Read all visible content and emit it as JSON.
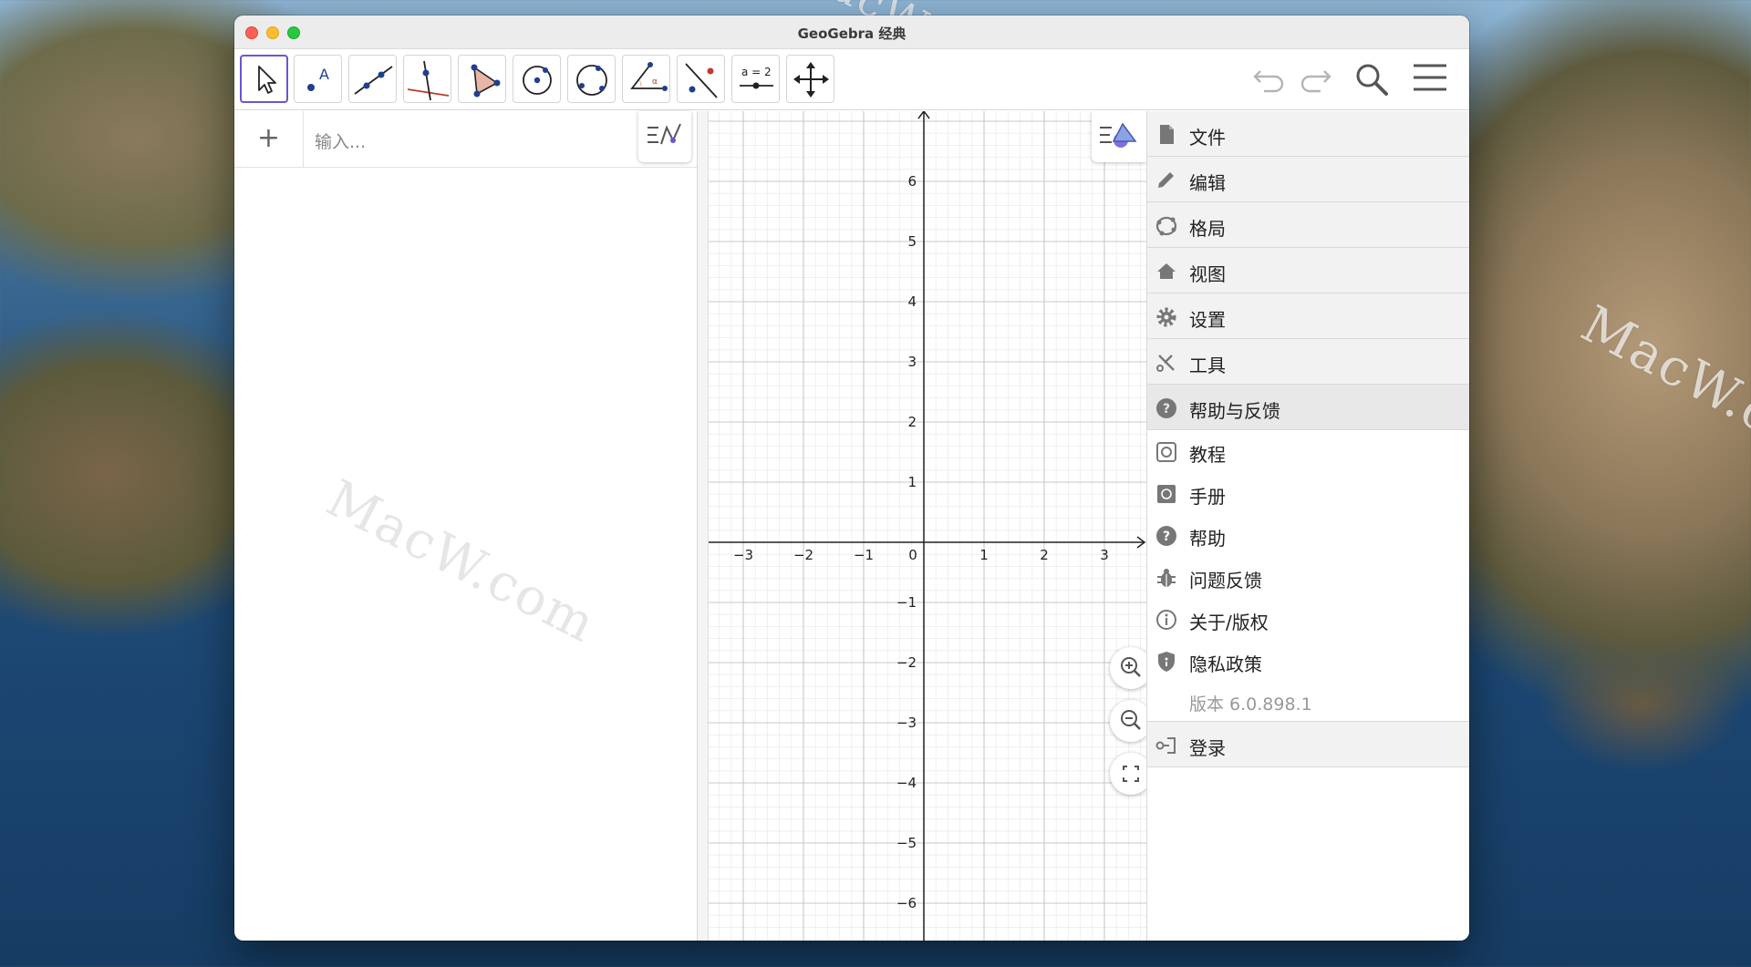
{
  "window": {
    "title": "GeoGebra 经典"
  },
  "toolbar": {
    "tools": [
      {
        "name": "move-tool"
      },
      {
        "name": "point-tool"
      },
      {
        "name": "line-tool"
      },
      {
        "name": "perpendicular-line-tool"
      },
      {
        "name": "polygon-tool"
      },
      {
        "name": "circle-center-point-tool"
      },
      {
        "name": "circle-three-points-tool"
      },
      {
        "name": "angle-tool"
      },
      {
        "name": "reflect-tool"
      },
      {
        "name": "slider-tool",
        "label": "a = 2"
      },
      {
        "name": "move-graphics-view-tool"
      }
    ],
    "right_icons": [
      "undo-icon",
      "redo-icon",
      "search-icon",
      "hamburger-menu-icon"
    ]
  },
  "algebra": {
    "plus_label": "+",
    "input_placeholder": "输入..."
  },
  "graphics": {
    "x_ticks": [
      "−3",
      "−2",
      "−1",
      "0",
      "1",
      "2",
      "3"
    ],
    "y_ticks_pos": [
      "6",
      "5",
      "4",
      "3",
      "2",
      "1"
    ],
    "y_ticks_neg": [
      "−1",
      "−2",
      "−3",
      "−4",
      "−5",
      "−6"
    ],
    "zoom_buttons": [
      "zoom-in-icon",
      "zoom-out-icon",
      "fullscreen-icon"
    ]
  },
  "menu": {
    "items": [
      {
        "label": "文件",
        "icon": "file-icon"
      },
      {
        "label": "编辑",
        "icon": "pencil-icon"
      },
      {
        "label": "格局",
        "icon": "perspectives-icon"
      },
      {
        "label": "视图",
        "icon": "home-icon"
      },
      {
        "label": "设置",
        "icon": "gear-icon"
      },
      {
        "label": "工具",
        "icon": "tools-icon"
      },
      {
        "label": "帮助与反馈",
        "icon": "help-icon"
      }
    ],
    "help_sub": [
      {
        "label": "教程",
        "icon": "tutorial-icon"
      },
      {
        "label": "手册",
        "icon": "manual-icon"
      },
      {
        "label": "帮助",
        "icon": "help-circle-icon"
      },
      {
        "label": "问题反馈",
        "icon": "bug-icon"
      },
      {
        "label": "关于/版权",
        "icon": "info-icon"
      },
      {
        "label": "隐私政策",
        "icon": "shield-icon"
      }
    ],
    "version": "版本 6.0.898.1",
    "signin": {
      "label": "登录",
      "icon": "signin-icon"
    }
  },
  "watermarks": [
    "MacW.com",
    "MacW.com",
    "MacW.com"
  ],
  "colors": {
    "accent": "#6557d2",
    "point": "#1f3f8f",
    "polygon_fill": "#e8b6a6"
  }
}
